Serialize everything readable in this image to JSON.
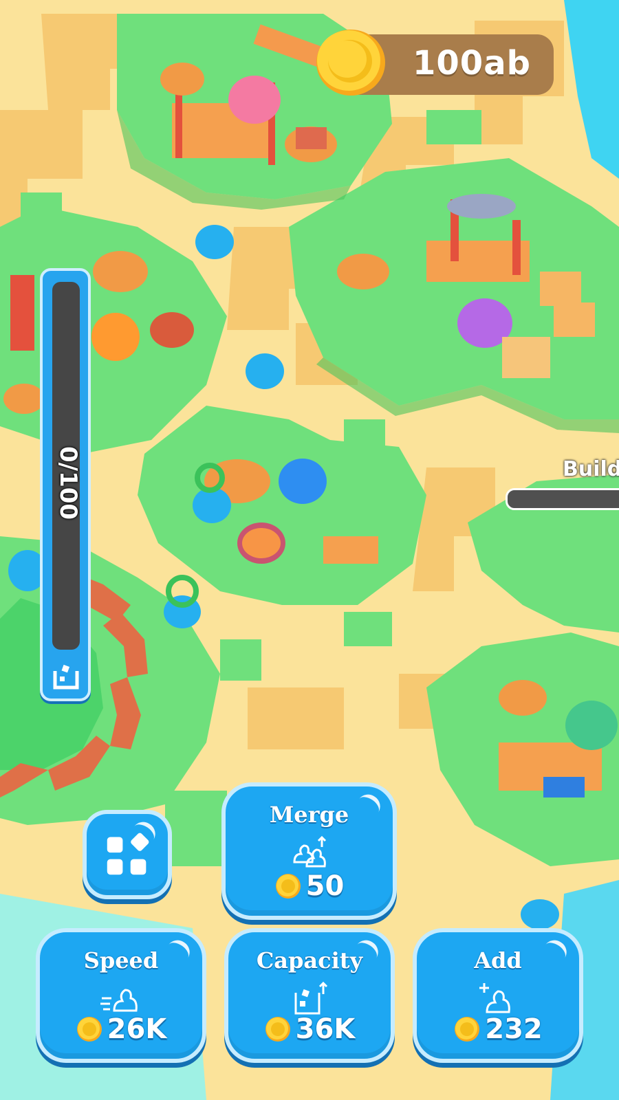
{
  "hud": {
    "coins": "100ab",
    "capacity_meter": "0/100",
    "build_label": "Build"
  },
  "buttons": {
    "merge": {
      "label": "Merge",
      "cost": "50",
      "icon": "merge-ducks-icon"
    },
    "speed": {
      "label": "Speed",
      "cost": "26K",
      "icon": "speed-duck-icon"
    },
    "capacity": {
      "label": "Capacity",
      "cost": "36K",
      "icon": "capacity-box-icon"
    },
    "add": {
      "label": "Add",
      "cost": "232",
      "icon": "add-duck-icon"
    },
    "menu": {
      "icon": "grid-menu-icon"
    }
  },
  "colors": {
    "button_blue": "#1da7f2",
    "grass": "#6fe07c",
    "sand": "#fbe39a",
    "coin_gold": "#f6c21c",
    "coin_bar": "#a97d4b"
  }
}
